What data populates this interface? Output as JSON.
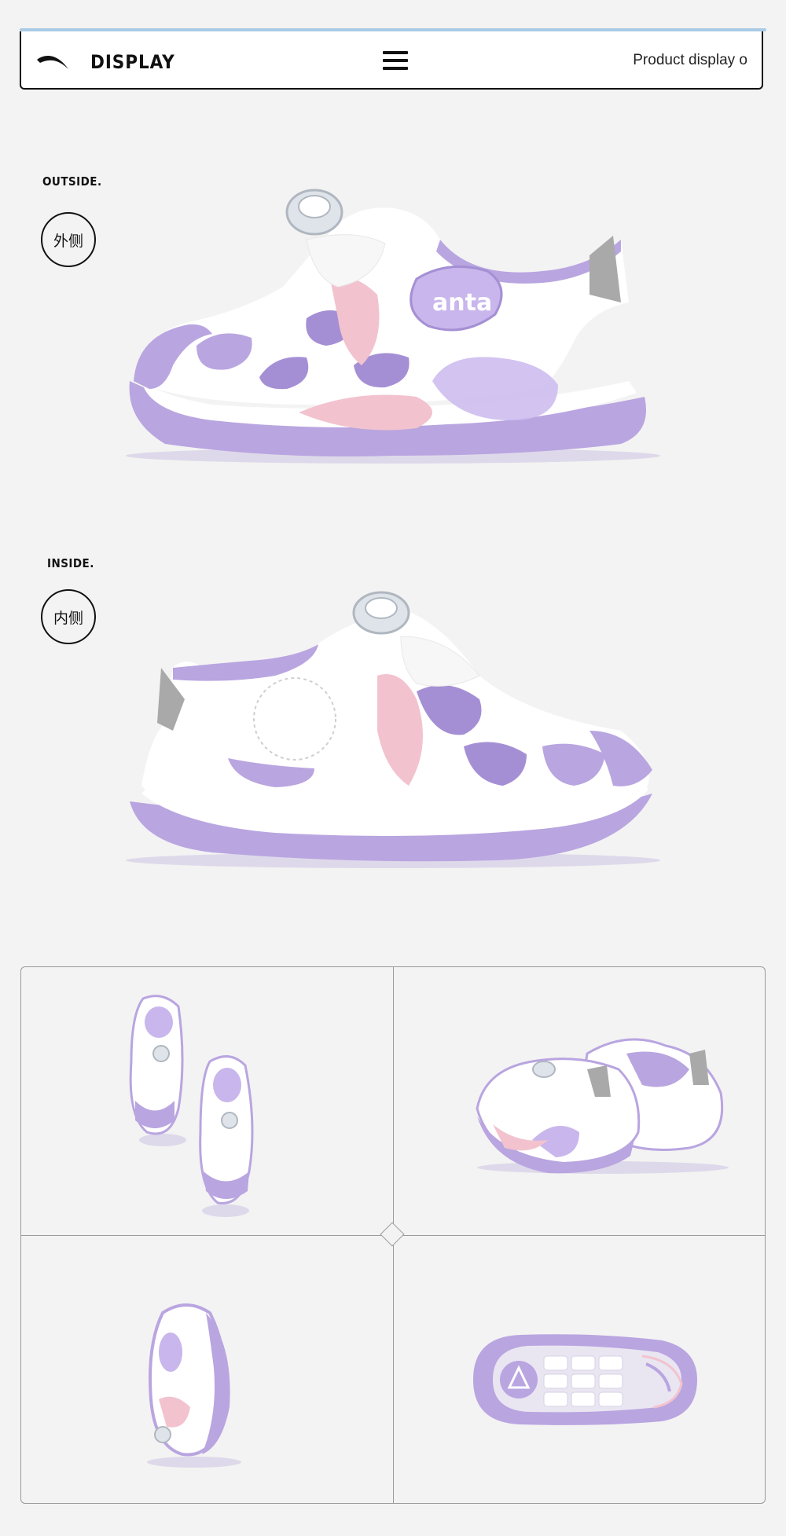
{
  "header": {
    "title": "DISPLAY",
    "right_text": "Product display o",
    "menu_icon": "hamburger-icon",
    "logo": "anta-logo"
  },
  "views": [
    {
      "label": "OUTSIDE.",
      "badge": "外侧",
      "brand_text": "anta"
    },
    {
      "label": "INSIDE.",
      "badge": "内侧"
    }
  ],
  "gallery": {
    "cells": [
      "top-view",
      "rear-angle-view",
      "front-angle-view",
      "sole-view"
    ]
  },
  "colors": {
    "background": "#f3f3f3",
    "lavender": "#b9a5e0",
    "pink": "#f2c3ce",
    "white": "#ffffff",
    "accent_line": "#a9cbe6"
  }
}
